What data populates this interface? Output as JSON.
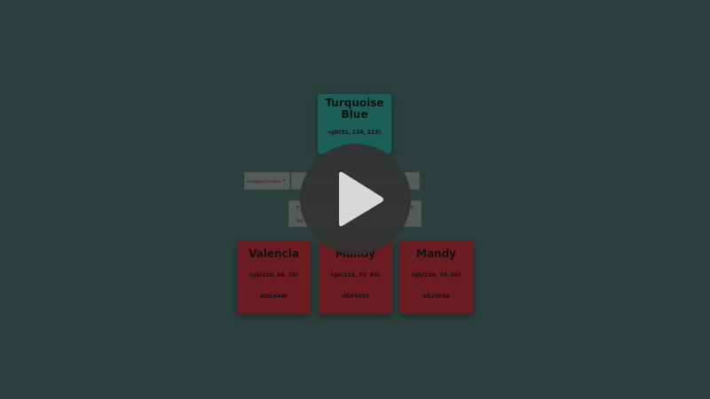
{
  "selector": {
    "value": "analogous-complex",
    "caret_icon": "chevron-down-icon"
  },
  "input": {
    "value": ""
  },
  "info": {
    "line1": "T",
    "line2": "RG",
    "right1": "5"
  },
  "main_color": {
    "name": "Turquoise Blue",
    "rgb": "rgb(92, 234, 223)",
    "color": "#1c5f58"
  },
  "palette": [
    {
      "name": "Valencia",
      "rgb": "rgb(220, 68, 79)",
      "hex": "#DC444F",
      "color": "#6b1c21"
    },
    {
      "name": "Mandy",
      "rgb": "rgb(223, 73, 85)",
      "hex": "#DF4955",
      "color": "#6b1c21"
    },
    {
      "name": "Mandy",
      "rgb": "rgb(226, 79, 90)",
      "hex": "#E24F5A",
      "color": "#6b1c21"
    }
  ],
  "overlay": {
    "icon": "play-icon",
    "background": "#2b3f3d"
  }
}
